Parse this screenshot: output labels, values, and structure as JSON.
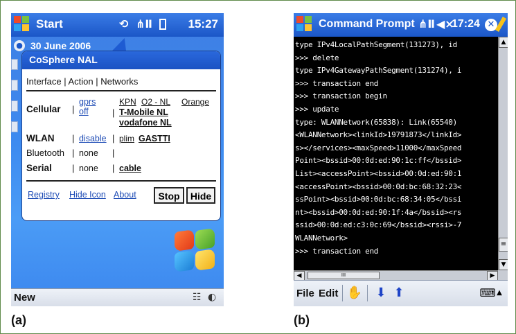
{
  "captions": {
    "a": "(a)",
    "b": "(b)"
  },
  "screen_a": {
    "title": "Start",
    "clock": "15:27",
    "status_icons": [
      "sync-icon",
      "signal-antenna-icon",
      "battery-icon"
    ],
    "date": "30 June 2006",
    "bubble": {
      "title": "CoSphere NAL",
      "header": "Interface | Action  | Networks",
      "rows": {
        "cellular": {
          "label": "Cellular",
          "sep1": "|",
          "action1": "gprs",
          "action2": "off",
          "sep2": "|",
          "net1": "KPN",
          "net2": "O2 - NL",
          "net3": "Orange",
          "net4": "T-Mobile NL",
          "net5": "vodafone NL"
        },
        "wlan": {
          "label": "WLAN",
          "sep1": "|",
          "action": "disable",
          "sep2": "|",
          "net1": "plim",
          "net2": "GASTTI"
        },
        "bluetooth": {
          "label": "Bluetooth",
          "sep1": "|",
          "action": "none",
          "sep2": "|"
        },
        "serial": {
          "label": "Serial",
          "sep1": "|",
          "action": "none",
          "sep2": "|",
          "net1": "cable"
        }
      },
      "footer_links": {
        "registry": "Registry",
        "hide_icon": "Hide Icon",
        "about": "About"
      },
      "buttons": {
        "stop": "Stop",
        "hide": "Hide"
      }
    },
    "bottom": {
      "softkey": "New"
    }
  },
  "screen_b": {
    "title": "Command Prompt",
    "clock": "17:24",
    "console_lines": [
      "type IPv4LocalPathSegment(131273), id",
      ">>> delete",
      "type IPv4GatewayPathSegment(131274), i",
      ">>> transaction end",
      ">>> transaction begin",
      ">>> update",
      "type: WLANNetwork(65838): Link(65540)",
      "<WLANNetwork><linkId>19791873</linkId>",
      "s></services><maxSpeed>11000</maxSpeed",
      "Point><bssid>00:0d:ed:90:1c:ff</bssid>",
      "List><accessPoint><bssid>00:0d:ed:90:1",
      "<accessPoint><bssid>00:0d:bc:68:32:23<",
      "ssPoint><bssid>00:0d:bc:68:34:05</bssi",
      "nt><bssid>00:0d:ed:90:1f:4a</bssid><rs",
      "ssid>00:0d:ed:c3:0c:69</bssid><rssi>-7",
      "WLANNetwork>",
      ">>> transaction end"
    ],
    "hscroll_thumb": "III",
    "menu": {
      "file": "File",
      "edit": "Edit"
    }
  }
}
